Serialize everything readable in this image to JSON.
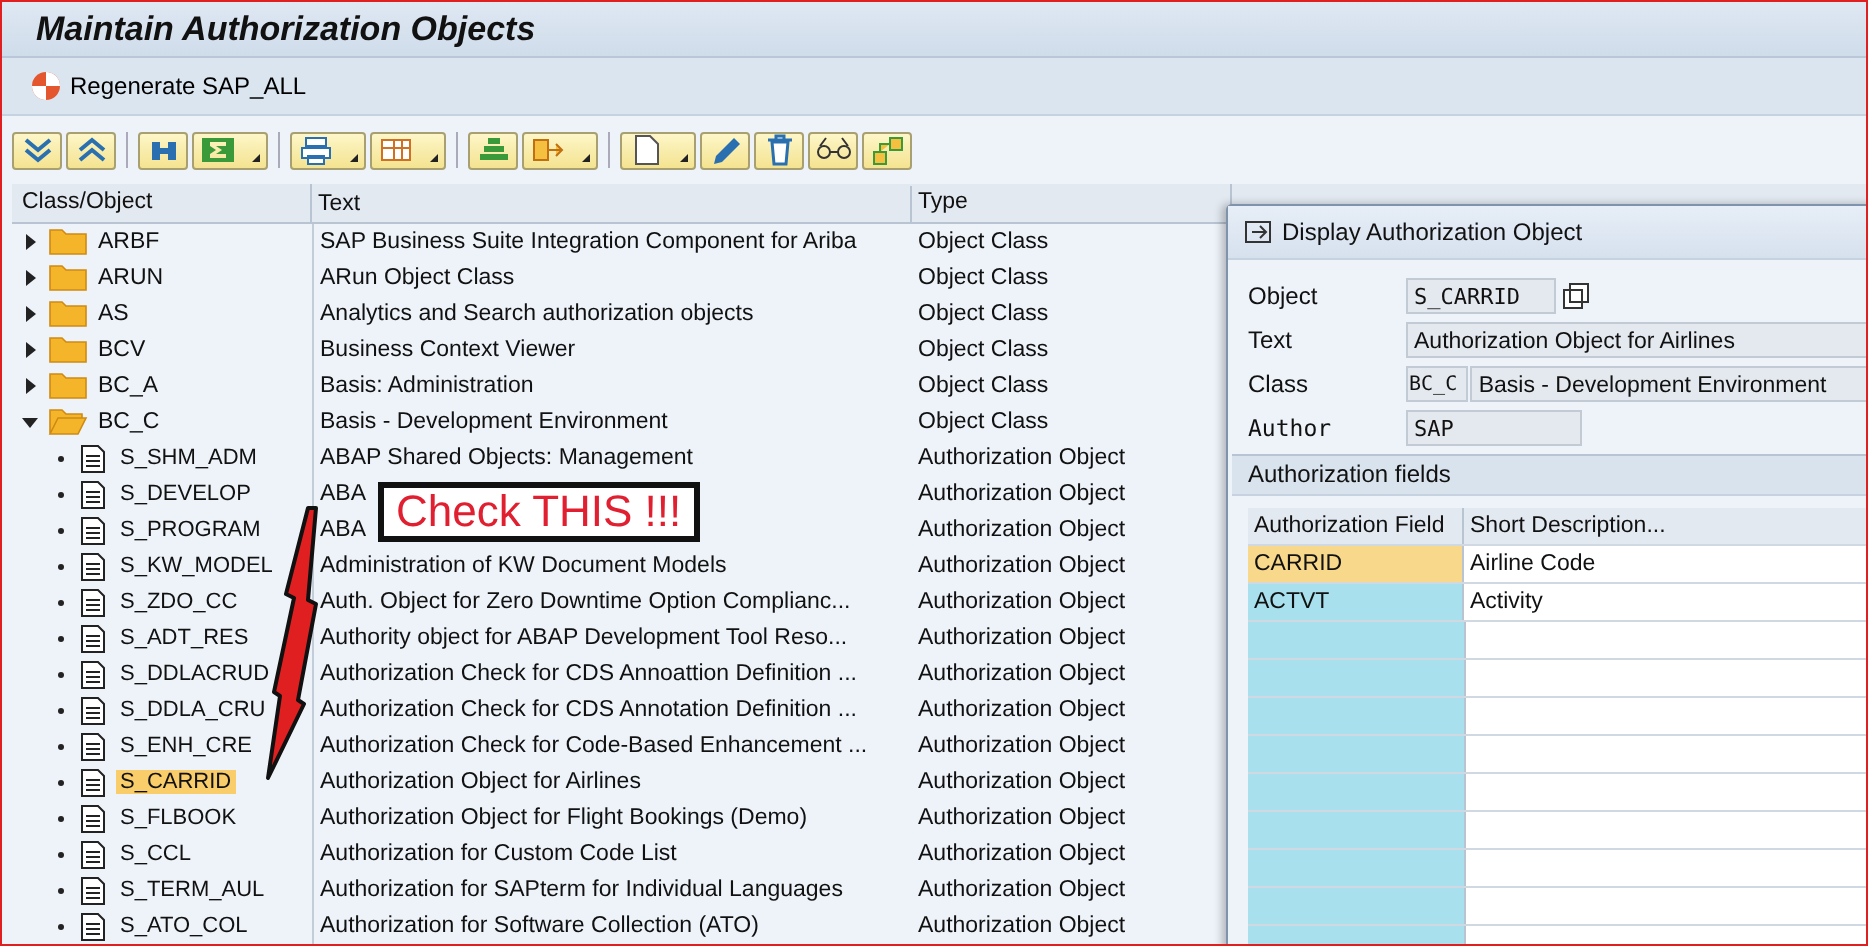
{
  "window": {
    "title": "Maintain Authorization Objects"
  },
  "app_toolbar": {
    "button": "Regenerate SAP_ALL"
  },
  "tree": {
    "columns": [
      "Class/Object",
      "Text",
      "Type"
    ],
    "items": [
      {
        "name": "ARBF",
        "text": "SAP Business Suite Integration Component for Ariba",
        "type": "Object Class",
        "expanded": false
      },
      {
        "name": "ARUN",
        "text": "ARun Object Class",
        "type": "Object Class",
        "expanded": false
      },
      {
        "name": "AS",
        "text": "Analytics and Search authorization objects",
        "type": "Object Class",
        "expanded": false
      },
      {
        "name": "BCV",
        "text": "Business Context Viewer",
        "type": "Object Class",
        "expanded": false
      },
      {
        "name": "BC_A",
        "text": "Basis: Administration",
        "type": "Object Class",
        "expanded": false
      },
      {
        "name": "BC_C",
        "text": "Basis - Development Environment",
        "type": "Object Class",
        "expanded": true,
        "children": [
          {
            "name": "S_SHM_ADM",
            "text": "ABAP Shared Objects: Management",
            "type": "Authorization Object",
            "selected": false
          },
          {
            "name": "S_DEVELOP",
            "text": "ABA",
            "type": "Authorization Object",
            "selected": false
          },
          {
            "name": "S_PROGRAM",
            "text": "ABA",
            "type": "Authorization Object",
            "selected": false
          },
          {
            "name": "S_KW_MODEL",
            "text": "Administration of KW Document Models",
            "type": "Authorization Object",
            "selected": false
          },
          {
            "name": "S_ZDO_CC",
            "text": "Auth. Object for Zero Downtime Option Complianc...",
            "type": "Authorization Object",
            "selected": false
          },
          {
            "name": "S_ADT_RES",
            "text": "Authority object for ABAP Development Tool Reso...",
            "type": "Authorization Object",
            "selected": false
          },
          {
            "name": "S_DDLACRUD",
            "text": "Authorization Check for CDS Annoattion Definition ...",
            "type": "Authorization Object",
            "selected": false
          },
          {
            "name": "S_DDLA_CRU",
            "text": "Authorization Check for CDS Annotation Definition ...",
            "type": "Authorization Object",
            "selected": false
          },
          {
            "name": "S_ENH_CRE",
            "text": "Authorization Check for Code-Based Enhancement ...",
            "type": "Authorization Object",
            "selected": false
          },
          {
            "name": "S_CARRID",
            "text": "Authorization Object for Airlines",
            "type": "Authorization Object",
            "selected": true
          },
          {
            "name": "S_FLBOOK",
            "text": "Authorization Object for Flight Bookings (Demo)",
            "type": "Authorization Object",
            "selected": false
          },
          {
            "name": "S_CCL",
            "text": "Authorization for Custom Code List",
            "type": "Authorization Object",
            "selected": false
          },
          {
            "name": "S_TERM_AUL",
            "text": "Authorization for SAPterm for Individual Languages",
            "type": "Authorization Object",
            "selected": false
          },
          {
            "name": "S_ATO_COL",
            "text": "Authorization for Software Collection (ATO)",
            "type": "Authorization Object",
            "selected": false
          }
        ]
      }
    ]
  },
  "callout": {
    "text": "Check THIS !!!"
  },
  "dialog": {
    "title": "Display Authorization Object",
    "fields": [
      {
        "label": "Object",
        "value": "S_CARRID",
        "kind": "object"
      },
      {
        "label": "Text",
        "value": "Authorization Object for Airlines",
        "kind": "wide"
      },
      {
        "label": "Class",
        "value": "BC_C",
        "extra": "Basis - Development Environment",
        "kind": "class"
      },
      {
        "label": "Author",
        "value": "SAP",
        "kind": "short"
      }
    ],
    "section": "Authorization fields",
    "columns": [
      "Authorization Field",
      "Short Description..."
    ],
    "rows": [
      {
        "field": "CARRID",
        "description": "Airline Code",
        "selected": true
      },
      {
        "field": "ACTVT",
        "description": "Activity",
        "selected": false
      }
    ]
  }
}
